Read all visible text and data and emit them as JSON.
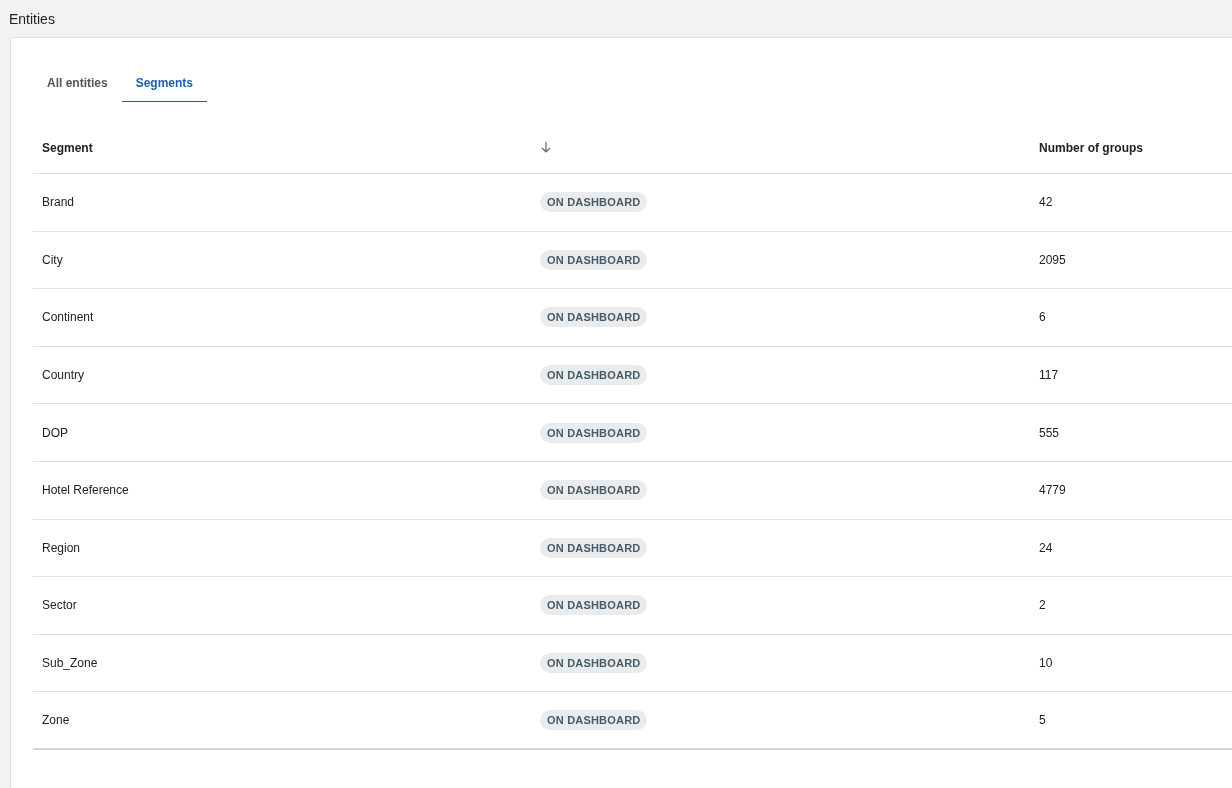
{
  "page": {
    "title": "Entities"
  },
  "tabs": [
    {
      "label": "All entities",
      "selected": false
    },
    {
      "label": "Segments",
      "selected": true
    }
  ],
  "table": {
    "columns": [
      {
        "label": "Segment",
        "kind": "text"
      },
      {
        "kind": "sort"
      },
      {
        "label": "Number of groups",
        "kind": "text"
      }
    ],
    "rows": [
      {
        "segment": "Brand",
        "status": "ON DASHBOARD",
        "groups": "42"
      },
      {
        "segment": "City",
        "status": "ON DASHBOARD",
        "groups": "2095"
      },
      {
        "segment": "Continent",
        "status": "ON DASHBOARD",
        "groups": "6"
      },
      {
        "segment": "Country",
        "status": "ON DASHBOARD",
        "groups": "117"
      },
      {
        "segment": "DOP",
        "status": "ON DASHBOARD",
        "groups": "555"
      },
      {
        "segment": "Hotel Reference",
        "status": "ON DASHBOARD",
        "groups": "4779"
      },
      {
        "segment": "Region",
        "status": "ON DASHBOARD",
        "groups": "24"
      },
      {
        "segment": "Sector",
        "status": "ON DASHBOARD",
        "groups": "2"
      },
      {
        "segment": "Sub_Zone",
        "status": "ON DASHBOARD",
        "groups": "10"
      },
      {
        "segment": "Zone",
        "status": "ON DASHBOARD",
        "groups": "5"
      }
    ]
  }
}
